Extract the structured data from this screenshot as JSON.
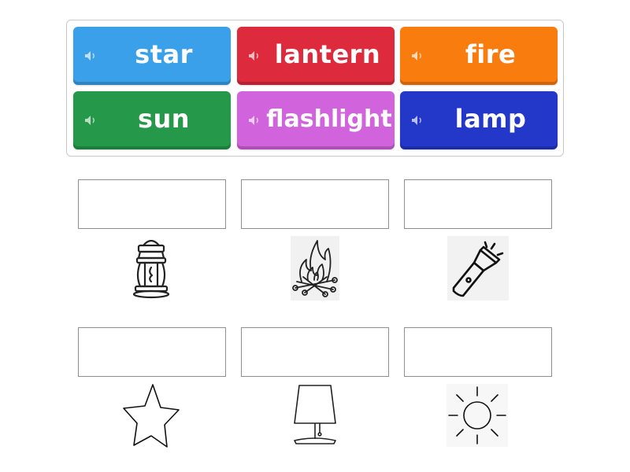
{
  "word_bank": {
    "tiles": [
      {
        "label": "star",
        "color": "#3aa0ea",
        "icon": "speaker-icon"
      },
      {
        "label": "lantern",
        "color": "#dd2a3c",
        "icon": "speaker-icon"
      },
      {
        "label": "fire",
        "color": "#f97c0e",
        "icon": "speaker-icon"
      },
      {
        "label": "sun",
        "color": "#25984a",
        "icon": "speaker-icon"
      },
      {
        "label": "flashlight",
        "color": "#d163dd",
        "icon": "speaker-icon"
      },
      {
        "label": "lamp",
        "color": "#2337c8",
        "icon": "speaker-icon"
      }
    ]
  },
  "targets": [
    {
      "picture": "lantern-image"
    },
    {
      "picture": "campfire-image"
    },
    {
      "picture": "flashlight-image"
    },
    {
      "picture": "star-image"
    },
    {
      "picture": "table-lamp-image"
    },
    {
      "picture": "sun-image"
    }
  ]
}
